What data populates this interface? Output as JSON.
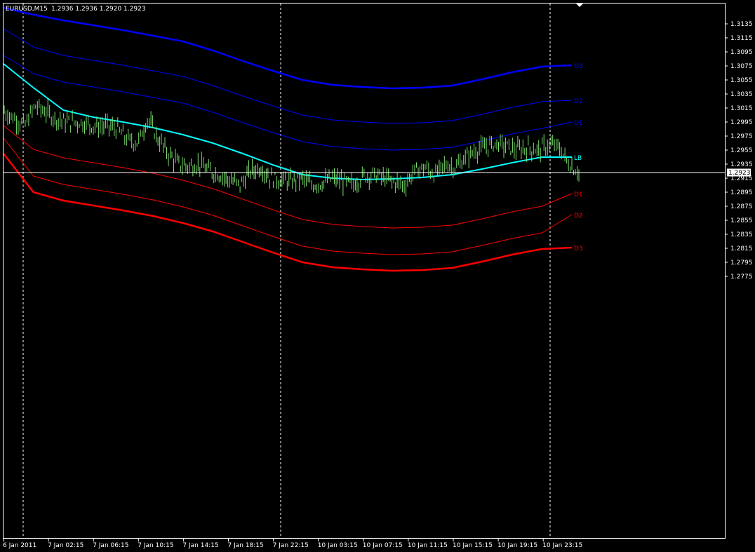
{
  "header": {
    "symbol": "EURUSD,M15",
    "ohlc": "1.2936 1.2936 1.2920 1.2923"
  },
  "price_marker": "1.2923",
  "chart_data": {
    "type": "line",
    "title": "",
    "xlabel": "",
    "ylabel": "",
    "ylim": [
      1.2768,
      1.315
    ],
    "grid": false,
    "y_ticks": [
      "1.3135",
      "1.3115",
      "1.3095",
      "1.3075",
      "1.3055",
      "1.3035",
      "1.3015",
      "1.2995",
      "1.2975",
      "1.2955",
      "1.2935",
      "1.2915",
      "1.2895",
      "1.2875",
      "1.2855",
      "1.2835",
      "1.2815",
      "1.2795",
      "1.2775"
    ],
    "x_ticks": [
      "6 Jan 2011",
      "7 Jan 02:15",
      "7 Jan 06:15",
      "7 Jan 10:15",
      "7 Jan 14:15",
      "7 Jan 18:15",
      "7 Jan 22:15",
      "10 Jan 03:15",
      "10 Jan 07:15",
      "10 Jan 11:15",
      "10 Jan 15:15",
      "10 Jan 19:15",
      "10 Jan 23:15"
    ],
    "session_separators": [
      "6 Jan 2011",
      "7 Jan 22:15",
      "10 Jan 23:15"
    ],
    "current_price": 1.2923,
    "colors": {
      "price": "#7CE06E",
      "upper": "#0000FF",
      "lower": "#FF0000",
      "midline": "#00FFFF",
      "axis": "#FFFFFF",
      "separator": "#FFFFFF"
    },
    "series": [
      {
        "name": "D3",
        "band": "upper",
        "thick": true,
        "values": [
          1.3158,
          1.3148,
          1.314,
          1.3133,
          1.3126,
          1.3118,
          1.311,
          1.3097,
          1.3082,
          1.3068,
          1.3055,
          1.3048,
          1.3045,
          1.3043,
          1.3044,
          1.3047,
          1.3056,
          1.3066,
          1.3074,
          1.3076
        ]
      },
      {
        "name": "D2",
        "band": "upper",
        "values": [
          1.3128,
          1.3102,
          1.309,
          1.3083,
          1.3076,
          1.3068,
          1.306,
          1.3047,
          1.3032,
          1.3018,
          1.3005,
          1.2998,
          1.2995,
          1.2993,
          1.2994,
          1.2997,
          1.3006,
          1.3016,
          1.3024,
          1.3026
        ]
      },
      {
        "name": "D1",
        "band": "upper",
        "values": [
          1.309,
          1.3064,
          1.3052,
          1.3045,
          1.3038,
          1.303,
          1.3022,
          1.3009,
          1.2994,
          1.298,
          1.2967,
          1.296,
          1.2957,
          1.2955,
          1.2956,
          1.2959,
          1.2968,
          1.2978,
          1.2986,
          1.2995
        ]
      },
      {
        "name": "LB",
        "band": "mid",
        "thick": true,
        "values": [
          1.3078,
          1.3044,
          1.3012,
          1.3002,
          1.2995,
          1.2987,
          1.2977,
          1.2965,
          1.295,
          1.2934,
          1.292,
          1.2915,
          1.2913,
          1.2914,
          1.2916,
          1.292,
          1.2928,
          1.2937,
          1.2945,
          1.2945
        ]
      },
      {
        "name": "D1",
        "band": "lower",
        "values": [
          1.299,
          1.2956,
          1.2944,
          1.2937,
          1.293,
          1.2922,
          1.2912,
          1.29,
          1.2885,
          1.287,
          1.2856,
          1.2849,
          1.2846,
          1.2844,
          1.2845,
          1.2848,
          1.2857,
          1.2867,
          1.2875,
          1.2893
        ]
      },
      {
        "name": "D2",
        "band": "lower",
        "values": [
          1.2972,
          1.2918,
          1.2906,
          1.2899,
          1.2892,
          1.2884,
          1.2874,
          1.2862,
          1.2847,
          1.2832,
          1.2818,
          1.2811,
          1.2808,
          1.2806,
          1.2807,
          1.281,
          1.2819,
          1.2829,
          1.2837,
          1.2863
        ]
      },
      {
        "name": "D3",
        "band": "lower",
        "thick": true,
        "values": [
          1.295,
          1.2895,
          1.2883,
          1.2876,
          1.2869,
          1.2861,
          1.2851,
          1.2839,
          1.2824,
          1.2809,
          1.2795,
          1.2788,
          1.2785,
          1.2783,
          1.2784,
          1.2787,
          1.2796,
          1.2806,
          1.2814,
          1.2816
        ]
      }
    ],
    "price_path": [
      1.301,
      1.3,
      1.299,
      1.3018,
      1.301,
      1.3,
      1.2995,
      1.2995,
      1.2993,
      1.2988,
      1.299,
      1.2985,
      1.297,
      1.2965,
      1.3,
      1.297,
      1.295,
      1.2935,
      1.2932,
      1.2935,
      1.2925,
      1.292,
      1.2912,
      1.2905,
      1.2925,
      1.293,
      1.2915,
      1.2912,
      1.291,
      1.2915,
      1.2905,
      1.2908,
      1.2915,
      1.291,
      1.2905,
      1.2918,
      1.292,
      1.2915,
      1.291,
      1.2905,
      1.2925,
      1.293,
      1.292,
      1.2935,
      1.293,
      1.2945,
      1.2955,
      1.296,
      1.2965,
      1.296,
      1.2955,
      1.2958,
      1.2955,
      1.2962,
      1.296,
      1.2935,
      1.2923
    ]
  }
}
